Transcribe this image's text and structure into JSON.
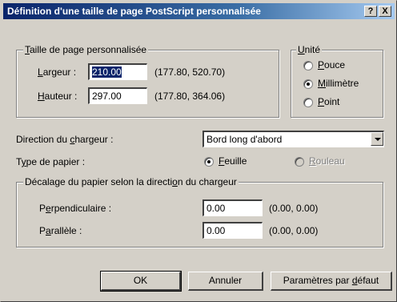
{
  "window": {
    "title": "Définition d'une taille de page PostScript personnalisée",
    "help_btn": "?",
    "close_btn": "X"
  },
  "page_size": {
    "group_label_u": "T",
    "group_label_rest": "aille de page personnalisée",
    "width_label_u": "L",
    "width_label_rest": "argeur :",
    "width_value": "210.00",
    "width_range": "(177.80, 520.70)",
    "height_label_u": "H",
    "height_label_rest": "auteur :",
    "height_value": "297.00",
    "height_range": "(177.80, 364.06)"
  },
  "unit": {
    "group_label_u": "U",
    "group_label_rest": "nité",
    "options": [
      {
        "u": "P",
        "rest": "ouce",
        "pre": "",
        "checked": false
      },
      {
        "u": "M",
        "rest": "illimètre",
        "pre": "",
        "checked": true
      },
      {
        "u": "P",
        "rest": "oint",
        "pre": "",
        "checked": false
      }
    ]
  },
  "feed": {
    "label_pre": "Direction du ",
    "label_u": "c",
    "label_rest": "hargeur :",
    "value": "Bord long d'abord"
  },
  "paper_type": {
    "label_pre": "T",
    "label_u": "y",
    "label_rest": "pe de papier :",
    "sheet_u": "F",
    "sheet_rest": "euille",
    "roll_u": "R",
    "roll_rest": "ouleau"
  },
  "offset": {
    "group_label_pre": "Décalage du papier selon la directi",
    "group_label_u": "o",
    "group_label_rest": "n du chargeur",
    "perp_pre": "P",
    "perp_u": "e",
    "perp_rest": "rpendiculaire :",
    "perp_value": "0.00",
    "perp_range": "(0.00, 0.00)",
    "par_pre": "P",
    "par_u": "a",
    "par_rest": "rallèle :",
    "par_value": "0.00",
    "par_range": "(0.00, 0.00)"
  },
  "buttons": {
    "ok": "OK",
    "cancel": "Annuler",
    "default_pre": "Paramètres par ",
    "default_u": "d",
    "default_rest": "éfaut"
  }
}
